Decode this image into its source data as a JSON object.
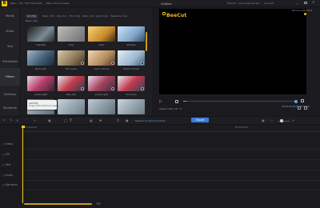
{
  "app": {
    "logo_letter": "B",
    "title": "Untitled",
    "brand_color": "#f2c218",
    "accent_color": "#3a7be0"
  },
  "menu": [
    "Menu",
    "File",
    "Edit",
    "View",
    "Help",
    "Make Intro Animate"
  ],
  "titlebar_right": [
    "Tutorial",
    "Live Chat",
    "Get VIP",
    "Account"
  ],
  "sidebar": {
    "items": [
      {
        "label": "Media",
        "icon": "media-icon"
      },
      {
        "label": "Music",
        "icon": "music-icon"
      },
      {
        "label": "Text",
        "icon": "text-icon"
      },
      {
        "label": "Transitions",
        "icon": "transitions-icon"
      },
      {
        "label": "Filters",
        "icon": "filters-icon"
      },
      {
        "label": "Overlays",
        "icon": "overlays-icon"
      },
      {
        "label": "Elements",
        "icon": "elements-icon"
      }
    ]
  },
  "filter_tabs": {
    "labels": [
      "All (76)",
      "Basic (25)",
      "Life (11)",
      "Film (16)",
      "Retro (11)",
      "Sport (21)",
      "Valentine (12)"
    ],
    "active_index": 0,
    "sub_tab": "Basic (22)"
  },
  "library": {
    "items": [
      {
        "label": "Vignette",
        "premium": false
      },
      {
        "label": "Gray",
        "premium": false
      },
      {
        "label": "Glow",
        "premium": false
      },
      {
        "label": "Shadow",
        "premium": false
      },
      {
        "label": "Blue light",
        "premium": false
      },
      {
        "label": "Film sepia",
        "premium": true
      },
      {
        "label": "warm sunrise",
        "premium": true
      },
      {
        "label": "Winter Sunset",
        "premium": true
      },
      {
        "label": "purple light",
        "premium": false
      },
      {
        "label": "Blue Sky",
        "premium": true
      },
      {
        "label": "purple light",
        "premium": true
      },
      {
        "label": "blue tone",
        "premium": true
      },
      {
        "label": "",
        "premium": false
      },
      {
        "label": "",
        "premium": false
      },
      {
        "label": "",
        "premium": false
      },
      {
        "label": "",
        "premium": false
      }
    ]
  },
  "tooltip": {
    "title": "Add HDJ",
    "body": "Drag to the timeline to apply"
  },
  "preview": {
    "watermark_text": "BeeCut",
    "remove_watermark": "Remove watermark",
    "time": "00:00:00.00/00:00:00.00",
    "aspect_label": "Aspect ratio",
    "aspect_value": "16 : 9"
  },
  "toolbar": {
    "speech_label": "Speech-to-Text Converter",
    "export_label": "Export"
  },
  "timeline": {
    "ticks": [
      "00:00:00:00",
      "00:00:02:00"
    ],
    "tracks": [
      {
        "label": "Video",
        "icon": "video-icon"
      },
      {
        "label": "PIP",
        "icon": "pip-icon"
      },
      {
        "label": "Text",
        "icon": "text-track-icon"
      },
      {
        "label": "Audio",
        "icon": "audio-icon"
      },
      {
        "label": "Narration",
        "icon": "narration-icon"
      }
    ]
  }
}
